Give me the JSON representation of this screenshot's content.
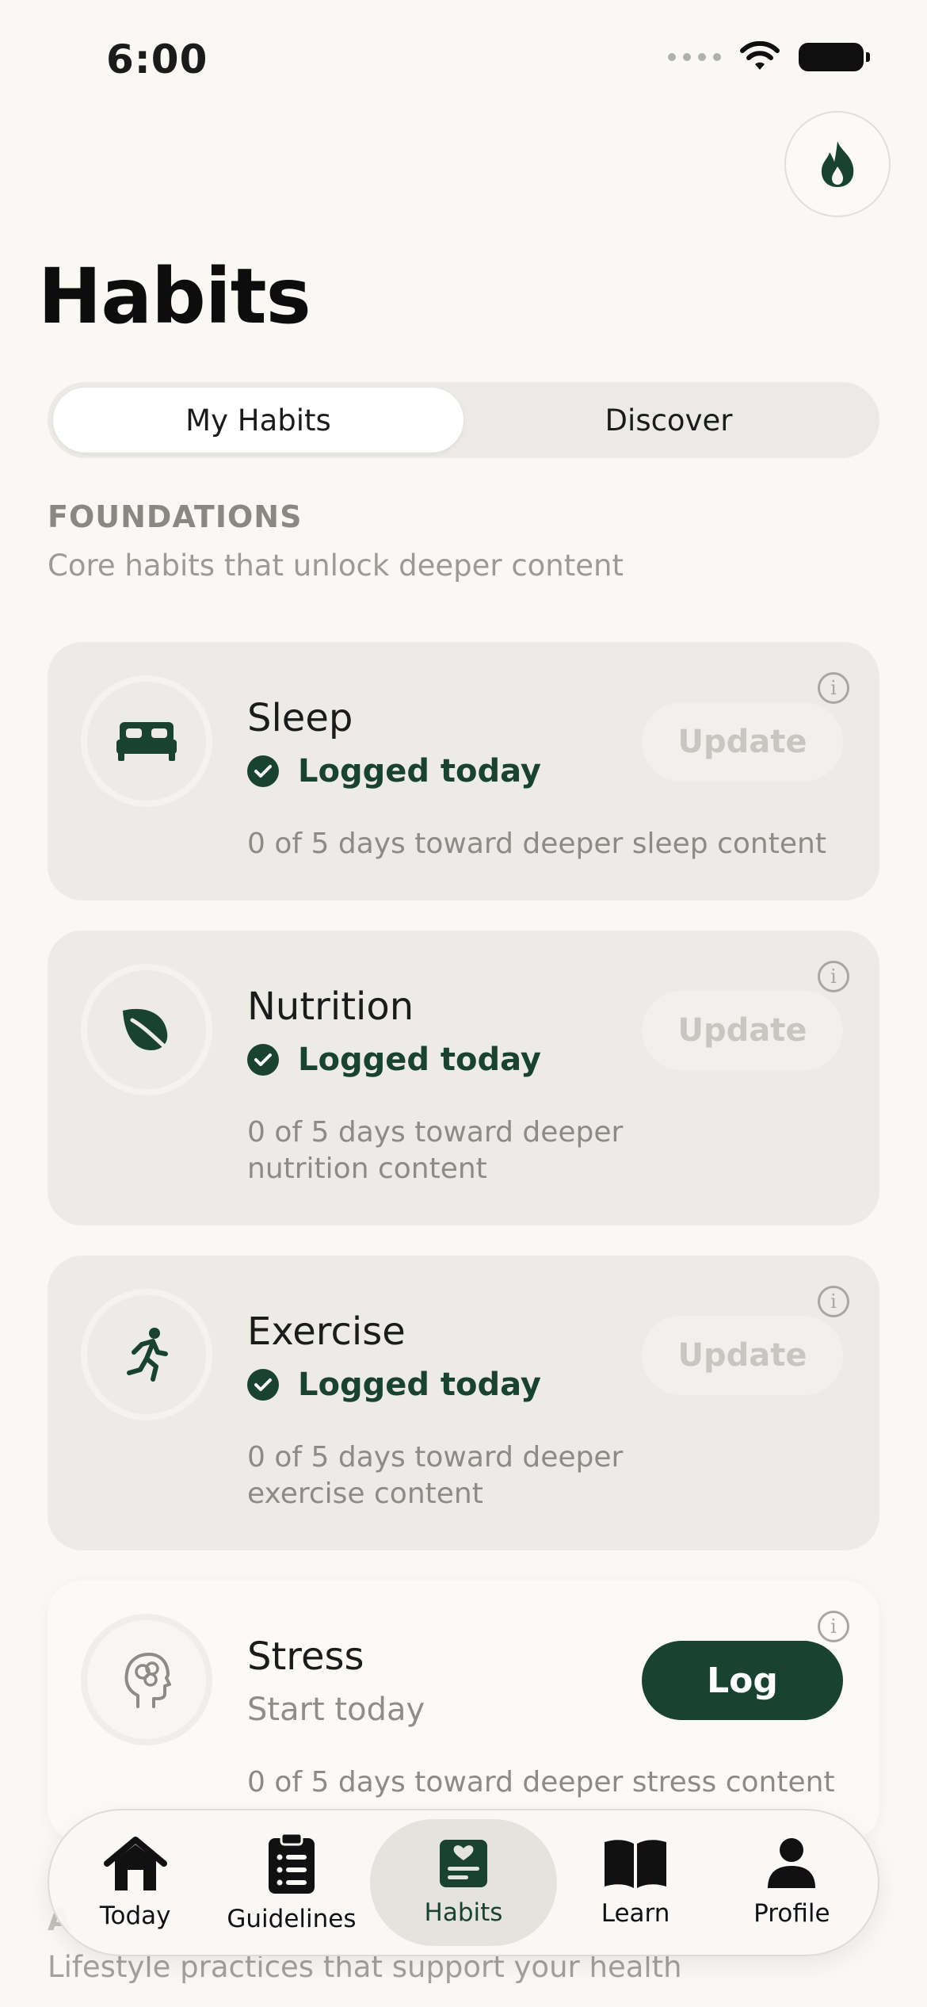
{
  "status_bar": {
    "time": "6:00"
  },
  "header": {
    "title": "Habits"
  },
  "tabs": [
    {
      "label": "My Habits",
      "active": true
    },
    {
      "label": "Discover",
      "active": false
    }
  ],
  "foundations": {
    "title": "FOUNDATIONS",
    "subtitle": "Core habits that unlock deeper content",
    "habits": [
      {
        "name": "Sleep",
        "icon": "bed-icon",
        "status": "Logged today",
        "progress": "0 of 5 days toward deeper sleep content",
        "action": "Update"
      },
      {
        "name": "Nutrition",
        "icon": "leaf-icon",
        "status": "Logged today",
        "progress": "0 of 5 days toward deeper nutrition content",
        "action": "Update"
      },
      {
        "name": "Exercise",
        "icon": "running-icon",
        "status": "Logged today",
        "progress": "0 of 5 days toward deeper exercise content",
        "action": "Update"
      },
      {
        "name": "Stress",
        "icon": "brain-head-icon",
        "status": "Start today",
        "progress": "0 of 5 days toward deeper stress content",
        "action": "Log"
      }
    ]
  },
  "section2": {
    "title": "A",
    "subtitle": "Lifestyle practices that support your health"
  },
  "bottom_nav": [
    {
      "label": "Today",
      "icon": "home-icon",
      "active": false
    },
    {
      "label": "Guidelines",
      "icon": "clipboard-icon",
      "active": false
    },
    {
      "label": "Habits",
      "icon": "habits-icon",
      "active": true
    },
    {
      "label": "Learn",
      "icon": "book-icon",
      "active": false
    },
    {
      "label": "Profile",
      "icon": "person-icon",
      "active": false
    }
  ],
  "colors": {
    "accent": "#1a4232",
    "background": "#f9f8f5",
    "card": "#ecebe7"
  }
}
